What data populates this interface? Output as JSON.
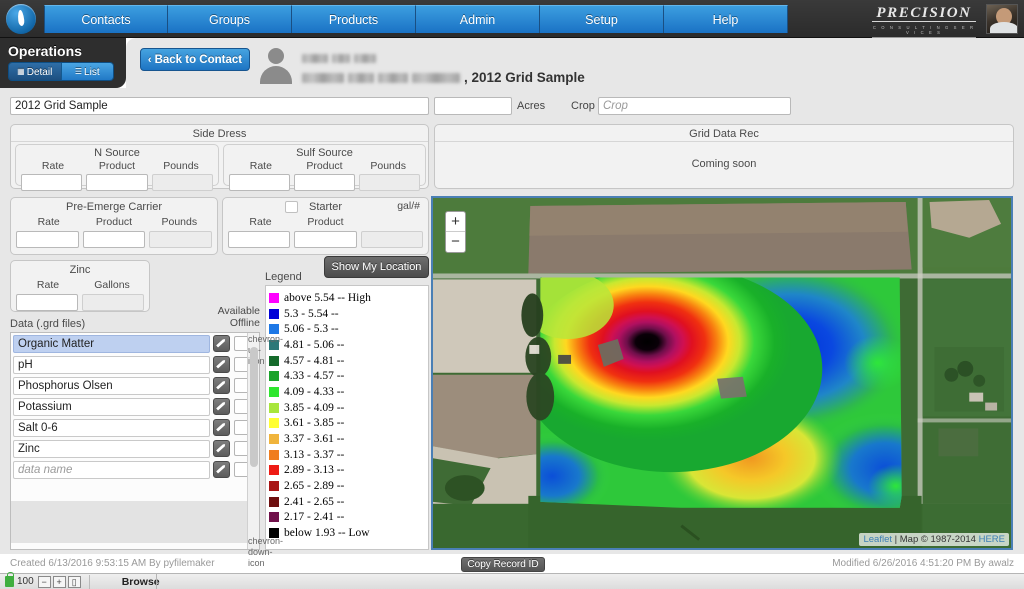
{
  "app": {
    "logo_icon": "flame-drop-logo",
    "brand_name": "PRECISION",
    "brand_tagline": "C O N S U L T I N G   S E R V I C E S",
    "avatar_icon": "user-photo-avatar"
  },
  "nav": {
    "items": [
      {
        "label": "Contacts"
      },
      {
        "label": "Groups"
      },
      {
        "label": "Products"
      },
      {
        "label": "Admin"
      },
      {
        "label": "Setup"
      },
      {
        "label": "Help"
      }
    ]
  },
  "sidebar": {
    "title": "Operations",
    "tabs": [
      {
        "label": "Detail",
        "icon": "detail-grid-icon",
        "active": true
      },
      {
        "label": "List",
        "icon": "list-lines-icon",
        "active": false
      }
    ]
  },
  "header": {
    "back_button": "Back to Contact",
    "back_chevron": "‹",
    "person_icon": "person-silhouette-icon",
    "contact_name_redacted": "",
    "contact_address_redacted": "",
    "record_title_suffix": ", 2012 Grid Sample"
  },
  "top_fields": {
    "title_value": "2012 Grid Sample",
    "acres_value": "",
    "acres_label": "Acres",
    "crop_label": "Crop",
    "crop_value": "",
    "crop_placeholder": "Crop"
  },
  "side_dress": {
    "title": "Side Dress",
    "n_source": {
      "title": "N Source",
      "columns": [
        "Rate",
        "Product",
        "Pounds"
      ],
      "values": [
        "",
        "",
        ""
      ]
    },
    "sulf_source": {
      "title": "Sulf Source",
      "columns": [
        "Rate",
        "Product",
        "Pounds"
      ],
      "values": [
        "",
        "",
        ""
      ]
    }
  },
  "pre_emerge": {
    "title": "Pre-Emerge Carrier",
    "columns": [
      "Rate",
      "Product",
      "Pounds"
    ],
    "values": [
      "",
      "",
      ""
    ]
  },
  "starter": {
    "title": "Starter",
    "unit_label": "gal/#",
    "columns": [
      "Rate",
      "Starter Product"
    ],
    "col_rate": "Rate",
    "col_product": "Product",
    "values": [
      "",
      "",
      ""
    ]
  },
  "zinc": {
    "title": "Zinc",
    "columns": [
      "Rate",
      "Gallons"
    ],
    "values": [
      "",
      ""
    ]
  },
  "grid_data_rec": {
    "title": "Grid Data Rec",
    "body": "Coming soon"
  },
  "map_tools": {
    "show_location_label": "Show My Location",
    "zoom_in": "+",
    "zoom_out": "−",
    "attribution_leaflet": "Leaflet",
    "attribution_sep": " | ",
    "attribution_map": "Map © 1987-2014 ",
    "attribution_provider": "HERE"
  },
  "legend": {
    "label": "Legend",
    "entries": [
      {
        "color": "#ff00ff",
        "text": "above 5.54 -- High"
      },
      {
        "color": "#0000d8",
        "text": "5.3 - 5.54 --"
      },
      {
        "color": "#1e78e6",
        "text": "5.06 - 5.3 --"
      },
      {
        "color": "#2d7878",
        "text": "4.81 - 5.06 --"
      },
      {
        "color": "#156b2c",
        "text": "4.57 - 4.81 --"
      },
      {
        "color": "#19a329",
        "text": "4.33 - 4.57 --"
      },
      {
        "color": "#2ee62e",
        "text": "4.09 - 4.33 --"
      },
      {
        "color": "#a8e63c",
        "text": "3.85 - 4.09 --"
      },
      {
        "color": "#ffff33",
        "text": "3.61 - 3.85 --"
      },
      {
        "color": "#f0b43c",
        "text": "3.37 - 3.61 --"
      },
      {
        "color": "#f07d1e",
        "text": "3.13 - 3.37 --"
      },
      {
        "color": "#ee1b14",
        "text": "2.89 - 3.13 --"
      },
      {
        "color": "#a81414",
        "text": "2.65 - 2.89 --"
      },
      {
        "color": "#6e0f0f",
        "text": "2.41 - 2.65 --"
      },
      {
        "color": "#70104a",
        "text": "2.17 - 2.41 --"
      },
      {
        "color": "#000000",
        "text": "below 1.93 -- Low"
      }
    ]
  },
  "data_files": {
    "label": "Data (.grd files)",
    "available_offline_line1": "Available",
    "available_offline_line2": "Offline",
    "edit_icon": "pencil-edit-icon",
    "scroll_up_icon": "chevron-up-icon",
    "scroll_down_icon": "chevron-down-icon",
    "rows": [
      {
        "name": "Organic Matter",
        "selected": true,
        "offline": false,
        "placeholder": false
      },
      {
        "name": "pH",
        "selected": false,
        "offline": false,
        "placeholder": false
      },
      {
        "name": "Phosphorus Olsen",
        "selected": false,
        "offline": false,
        "placeholder": false
      },
      {
        "name": "Potassium",
        "selected": false,
        "offline": false,
        "placeholder": false
      },
      {
        "name": "Salt 0-6",
        "selected": false,
        "offline": false,
        "placeholder": false
      },
      {
        "name": "Zinc",
        "selected": false,
        "offline": false,
        "placeholder": false
      },
      {
        "name": "data name",
        "selected": false,
        "offline": false,
        "placeholder": true
      }
    ]
  },
  "footer": {
    "created": "Created 6/13/2016 9:53:15 AM By pyfilemaker",
    "modified": "Modified 6/26/2016 4:51:20 PM By awalz",
    "copy_record_label": "Copy Record ID"
  },
  "statusbar": {
    "lock_icon": "green-lock-icon",
    "zoom_level": "100",
    "zoom_out_icon": "zoom-out-icon",
    "zoom_in_icon": "zoom-in-icon",
    "window_icon": "window-toggle-icon",
    "mode": "Browse"
  }
}
